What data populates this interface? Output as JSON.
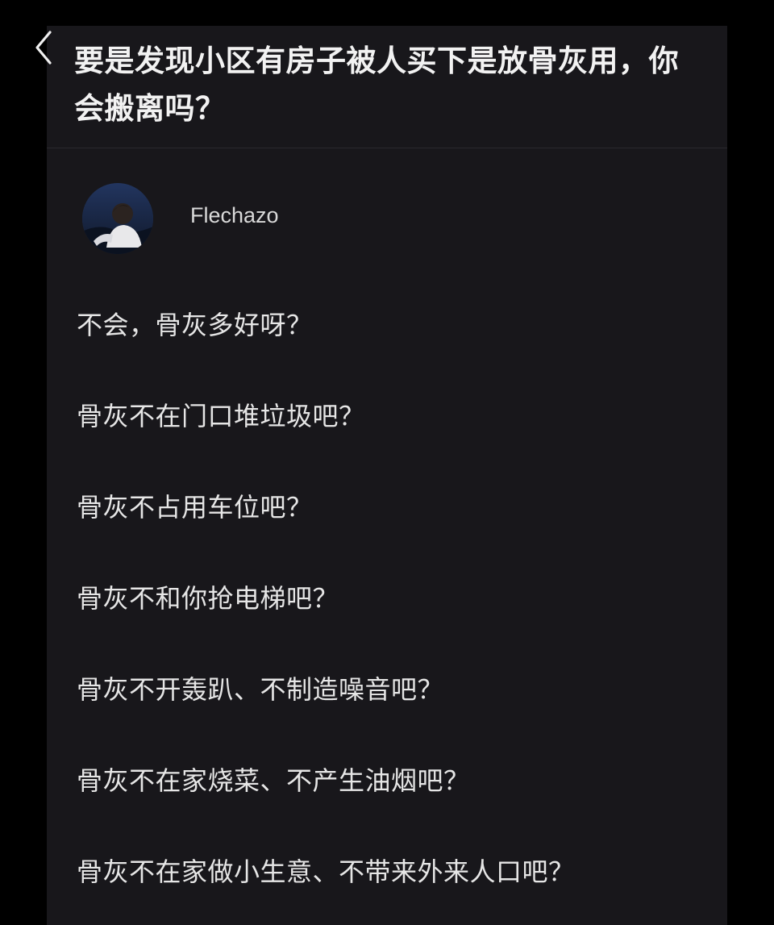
{
  "header": {
    "back_icon": "chevron-left-icon",
    "question_title": "要是发现小区有房子被人买下是放骨灰用，你会搬离吗？"
  },
  "author": {
    "avatar_icon": "user-avatar",
    "name": "Flechazo"
  },
  "answer": {
    "lines": [
      "不会，骨灰多好呀？",
      "骨灰不在门口堆垃圾吧？",
      "骨灰不占用车位吧？",
      "骨灰不和你抢电梯吧？",
      "骨灰不开轰趴、不制造噪音吧？",
      "骨灰不在家烧菜、不产生油烟吧？",
      "骨灰不在家做小生意、不带来外来人口吧？"
    ]
  },
  "colors": {
    "page_background": "#000000",
    "panel_background": "#18171b",
    "text_primary": "#f2f2f2",
    "text_secondary": "#d9d9d9"
  }
}
